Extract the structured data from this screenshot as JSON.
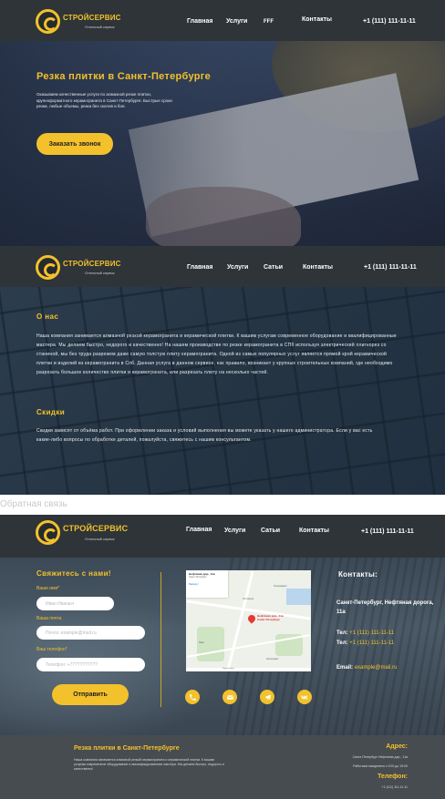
{
  "brand": {
    "name": "СТРОЙСЕРВИС",
    "tagline": "Отличный сервис"
  },
  "header1": {
    "nav": [
      "Главная",
      "Услуги",
      "FFF",
      "Контакты"
    ],
    "phone": "+1 (111) 111-11-11"
  },
  "header2": {
    "nav": [
      "Главная",
      "Услуги",
      "Сатьи",
      "Контакты"
    ],
    "phone": "+1 (111) 111-11-11"
  },
  "header3": {
    "nav": [
      "Главная",
      "Услуги",
      "Сатьи",
      "Контакты"
    ],
    "phone": "+1 (111) 111-11-11"
  },
  "hero": {
    "title": "Резка плитки в Санкт-Петербурге",
    "text": "Оказываем качественные услуги по алмазной резке плитки, крупноформатного керамогранита в Санкт-Петербурге. Быстрые сроки резки, любые объемы, резка без сколов и боя.",
    "button": "Заказать звонок"
  },
  "about": {
    "title": "О нас",
    "text": "Наша компания занимается алмазной резкой керамогранита и керамической плитки. К вашим услугам современное оборудование и квалифицированные мастера. Мы делаем быстро, недорого и качественно! На нашем производстве по резке керамогранита в СПб используя электрический плиткорез со станиной, мы без труда разрежем даже самую толстую плиту керамогранита. Одной из самых популярных услуг является прямой крой керамической плитки и изделий из керамогранита в Спб. Данная услуга в данном сервисе, как правило, возникает у крупных строительных компаний, где необходимо разрезать большое количество плитки и керамогранита, или разрезать плиту на несколько частей.",
    "discount_title": "Скидки",
    "discount_text": "Скидки зависят от объёма работ. При оформлении заказа и условий выполнения вы можете указать у нашего администратора. Если у вас есть какие-либо вопросы по обработке деталей, пожалуйста, свяжитесь с нашим консультантом."
  },
  "feedback_label": "Обратная связь",
  "form": {
    "title": "Свяжитесь с нами!",
    "name_label": "Ваше имя*",
    "name_placeholder": "Иван Иваныч",
    "email_label": "Ваша почта",
    "email_placeholder": "Почта: example@mail.ru",
    "phone_label": "Ваш телефон*",
    "phone_placeholder": "Телефон: +7??????????",
    "submit": "Отправить"
  },
  "map": {
    "card_title": "Нефтяная дор., 11а",
    "card_sub": "Санкт-Петербург",
    "card_link": "Маршрут",
    "pin_label": "Нефтяная дор., 11а Санкт-Петербург",
    "places": [
      "Гостиница",
      "Гипермаркет",
      "Парк",
      "Автосервис"
    ],
    "footer": "Яндекс Карты"
  },
  "contacts": {
    "title": "Контакты:",
    "address": "Санкт-Петербург, Нефтяная дорога, 11а",
    "tel1_label": "Тел:",
    "tel1": "+1 (111) 111-11-11",
    "tel2_label": "Тел:",
    "tel2": "+1 (111) 111-11-11",
    "email_label": "Email:",
    "email": "example@mail.ru"
  },
  "social_icons": [
    "phone-icon",
    "email-icon",
    "telegram-icon",
    "vk-icon"
  ],
  "footer": {
    "title": "Резка плитки в Санкт-Петербурге",
    "text": "Наша компания занимается алмазной резкой керамогранита и керамической плитки. К вашим услугам современное оборудование и квалифицированные мастера. Мы делаем быстро, недорого и качественно!",
    "address_head": "Адрес:",
    "address_line": "Санкт-Петербург Нефтяная дор., 11а",
    "hours": "Работаем ежедневно с 9:00 до 19:00",
    "phone_head": "Телефон:",
    "phone": "+1 (111) 111-11-11"
  },
  "colors": {
    "accent": "#f3c12c",
    "header": "#2e3438",
    "footer": "#474c50"
  }
}
